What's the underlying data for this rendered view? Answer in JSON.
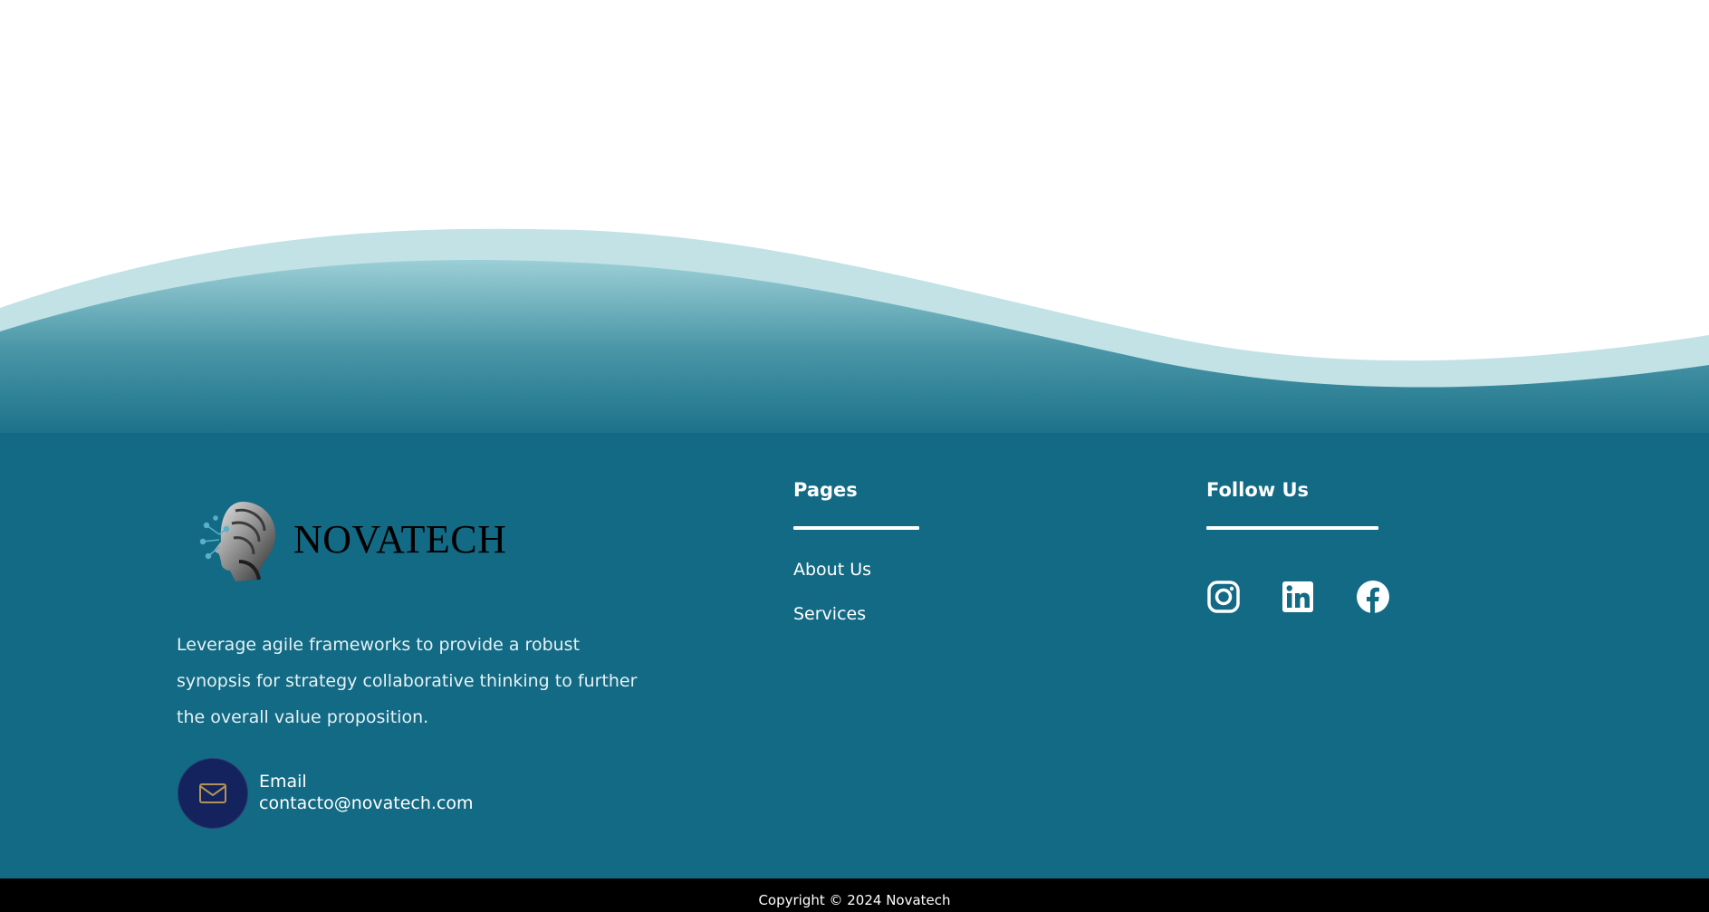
{
  "colors": {
    "footer_bg": "#126a84",
    "wave_light": "#c2e2e6",
    "email_badge_bg": "#14235e",
    "copyright_bg": "#000000",
    "text_light": "#ffffff"
  },
  "brand": {
    "name": "NOVATECH",
    "tagline": "Leverage agile frameworks to provide a robust synopsis for strategy collaborative thinking to further the overall value proposition."
  },
  "contact": {
    "icon": "envelope-icon",
    "label": "Email",
    "value": "contacto@novatech.com"
  },
  "pages": {
    "heading": "Pages",
    "links": [
      "About Us",
      "Services"
    ]
  },
  "follow": {
    "heading": "Follow Us",
    "icons": [
      "instagram-icon",
      "linkedin-icon",
      "facebook-icon"
    ]
  },
  "copyright": "Copyright © 2024 Novatech"
}
